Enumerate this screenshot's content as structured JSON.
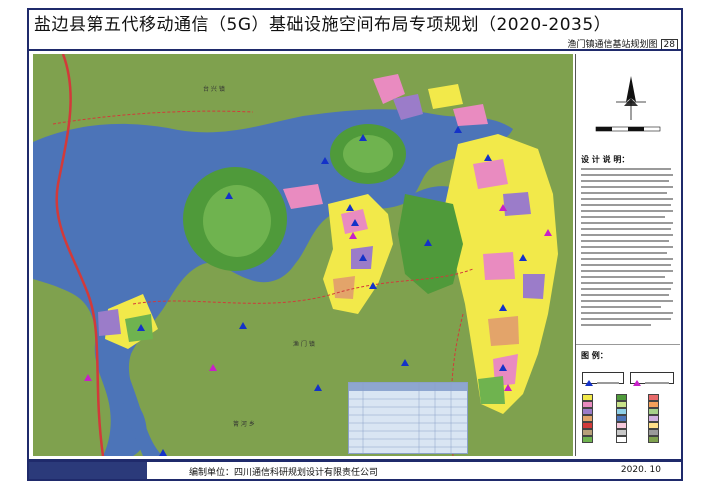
{
  "header": {
    "title": "盐边县第五代移动通信（5G）基础设施空间布局专项规划（2020-2035）",
    "subtitle": "渔门镇通信基站规划图",
    "sheet_number": "28"
  },
  "panel": {
    "notes_title": "设 计 说 明：",
    "legend_title": "图 例：",
    "legend_items": [
      "",
      ""
    ]
  },
  "map": {
    "labels": [
      {
        "text": "台 兴 镇"
      },
      {
        "text": "渔 门 镇"
      },
      {
        "text": "箐 河 乡"
      }
    ],
    "colors": {
      "water": "#4c74b8",
      "land": "#7fa14e",
      "forest": "#4f9a3a",
      "residential": "#f2e94a",
      "commercial": "#e98bc0",
      "public": "#9b7cc9",
      "industrial": "#b8a07a",
      "road_red": "#d23a3a",
      "site_existing": "#1432c8",
      "site_planned": "#c820c8"
    },
    "icons": [
      "north-arrow-icon",
      "scale-bar-icon",
      "base-station-icon"
    ]
  },
  "footer": {
    "org_label": "编制单位：四川通信科研规划设计有限责任公司",
    "date": "2020. 10"
  }
}
